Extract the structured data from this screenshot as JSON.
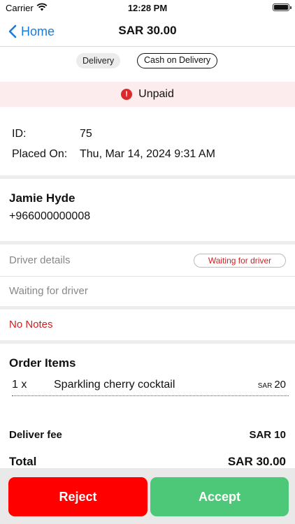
{
  "status_bar": {
    "carrier": "Carrier",
    "time": "12:28 PM"
  },
  "nav": {
    "back_label": "Home",
    "title": "SAR 30.00"
  },
  "tags": {
    "delivery": "Delivery",
    "payment": "Cash on Delivery"
  },
  "payment_status": {
    "text": "Unpaid",
    "icon": "!"
  },
  "order": {
    "id_label": "ID:",
    "id_value": "75",
    "placed_label": "Placed On:",
    "placed_value": "Thu, Mar 14, 2024 9:31 AM"
  },
  "customer": {
    "name": "Jamie Hyde",
    "phone": "+966000000008"
  },
  "driver": {
    "section_label": "Driver details",
    "badge": "Waiting for driver",
    "status": "Waiting for driver"
  },
  "notes": "No Notes",
  "items": {
    "title": "Order Items",
    "list": [
      {
        "qty": "1 x",
        "name": "Sparkling cherry cocktail",
        "currency": "SAR",
        "price": "20"
      }
    ]
  },
  "summary": {
    "fee_label": "Deliver fee",
    "fee_value": "SAR 10",
    "total_label": "Total",
    "total_value": "SAR 30.00"
  },
  "actions": {
    "reject": "Reject",
    "accept": "Accept"
  },
  "colors": {
    "accent": "#1a7bd8",
    "danger": "#ff0000",
    "success": "#4dc878",
    "banner": "#fdecee"
  }
}
